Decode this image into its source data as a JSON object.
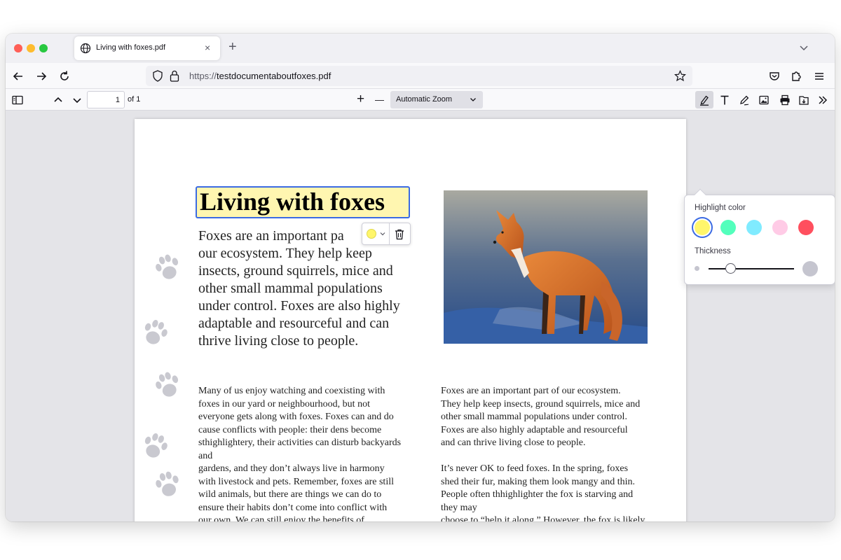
{
  "tab": {
    "title": "Living with foxes.pdf",
    "close": "×",
    "new_tab": "+"
  },
  "url": {
    "scheme": "https://",
    "host": "testdocumentaboutfoxes.pdf"
  },
  "pdf_toolbar": {
    "page_number": "1",
    "page_of": "of 1",
    "zoom_in": "+",
    "zoom_out": "—",
    "zoom_label": "Automatic Zoom"
  },
  "document": {
    "title": "Living with foxes",
    "lead": "Foxes are an important part of our ecosystem. They help keep insects, ground squirrels, mice and other small mammal populations under control. Foxes are also highly adaptable and resourceful and can thrive living close to people.",
    "lead_visible": "Foxes are an important pa",
    "lead_rest": "our ecosystem. They help keep insects, ground squirrels, mice and other small mammal populations under control. Foxes are also highly adaptable and resourceful and can thrive living close to people.",
    "col_left": "Many of us enjoy watching and coexisting with\nfoxes in our yard or neighbourhood, but not\neveryone gets along with foxes. Foxes can and do\ncause conflicts with people: their dens become\nsthighlightery, their activities can disturb backyards\nand\ngardens, and they don’t always live in harmony\nwith livestock and pets. Remember, foxes are still\nwild animals, but there are things we can do to\nensure their habits don’t come into conflict with\nour own. We can still enjoy the benefits of",
    "col_right": "Foxes are an important part of our ecosystem.\nThey help keep insects, ground squirrels, mice and\nother small mammal populations under control.\nFoxes are also highly adaptable and resourceful\nand can thrive living close to people.\n\nIt’s never OK to feed foxes. In the spring, foxes\nshed their fur, making them look mangy and thin.\nPeople often thhighlighter the fox is starving and\nthey may\nchoose to “help it along.” However, the fox is likely"
  },
  "highlight_popup": {
    "color_label": "Highlight color",
    "thickness_label": "Thickness",
    "colors": [
      "#fff66b",
      "#53ffbc",
      "#80ebff",
      "#ffcbe6",
      "#ff4f5e"
    ],
    "selected_color": "#fff66b",
    "thickness_fraction": 0.25
  },
  "icons": [
    "globe-icon",
    "back-icon",
    "forward-icon",
    "reload-icon",
    "shield-icon",
    "lock-icon",
    "bookmark-star-icon",
    "pocket-icon",
    "extensions-icon",
    "menu-icon",
    "sidebar-toggle-icon",
    "page-up-icon",
    "page-down-icon",
    "highlight-icon",
    "text-icon",
    "draw-icon",
    "image-icon",
    "print-icon",
    "save-icon",
    "more-tools-icon",
    "trash-icon",
    "paw-icon"
  ]
}
